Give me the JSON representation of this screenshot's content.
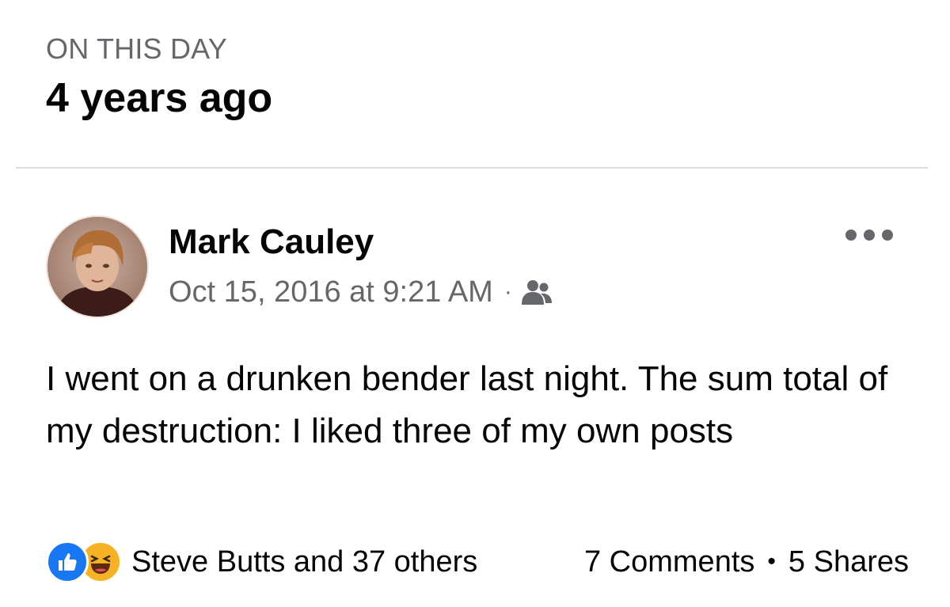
{
  "memory": {
    "kicker": "ON THIS DAY",
    "years_ago": "4 years ago"
  },
  "post": {
    "author": "Mark Cauley",
    "timestamp": "Oct 15, 2016 at 9:21 AM",
    "separator": "·",
    "audience_icon": "friends-icon",
    "more_icon": "more-options-icon",
    "text": "I went on a drunken bender last night. The sum total of my destruction: I liked three of my own posts"
  },
  "footer": {
    "reaction_icons": [
      "like-icon",
      "haha-icon"
    ],
    "reactors": "Steve Butts and 37 others",
    "comments": "7 Comments",
    "separator": "•",
    "shares": "5 Shares"
  },
  "colors": {
    "like_blue": "#1877f2",
    "haha_yellow": "#f7b125",
    "secondary_text": "#65676b",
    "divider": "#dadde1"
  }
}
